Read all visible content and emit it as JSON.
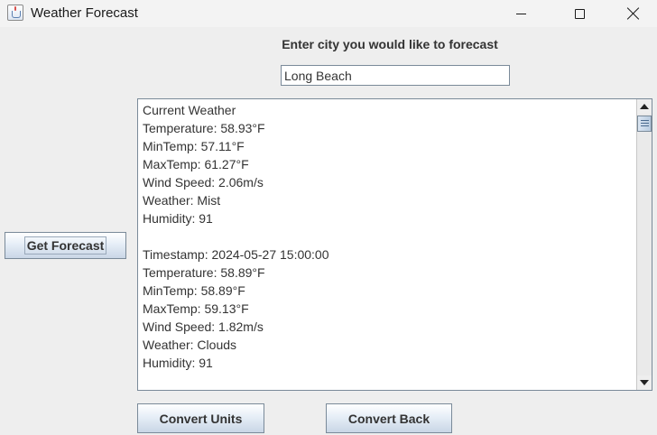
{
  "window": {
    "title": "Weather Forecast"
  },
  "form": {
    "prompt": "Enter city you would like to forecast",
    "city_value": "Long Beach"
  },
  "buttons": {
    "get_forecast": "Get Forecast",
    "convert_units": "Convert Units",
    "convert_back": "Convert Back"
  },
  "output": {
    "lines": [
      "Current Weather",
      "Temperature: 58.93°F",
      "MinTemp: 57.11°F",
      "MaxTemp: 61.27°F",
      "Wind Speed: 2.06m/s",
      "Weather: Mist",
      "Humidity: 91",
      "",
      "Timestamp: 2024-05-27 15:00:00",
      "Temperature: 58.89°F",
      "MinTemp: 58.89°F",
      "MaxTemp: 59.13°F",
      "Wind Speed: 1.82m/s",
      "Weather: Clouds",
      "Humidity: 91"
    ]
  },
  "icons": {
    "app": "java-cup-icon",
    "minimize": "minimize-icon",
    "maximize": "maximize-icon",
    "close": "close-icon",
    "scroll_up": "arrow-up-icon",
    "scroll_down": "arrow-down-icon"
  }
}
